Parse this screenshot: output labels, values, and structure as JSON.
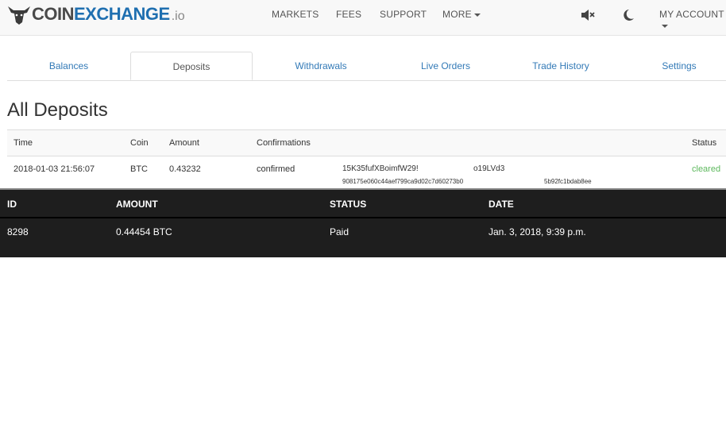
{
  "header": {
    "logo_coin": "COIN",
    "logo_exchange": "EXCHANGE",
    "logo_io": ".io",
    "nav": [
      "MARKETS",
      "FEES",
      "SUPPORT",
      "MORE"
    ],
    "account": "MY ACCOUNT"
  },
  "tabs": [
    "Balances",
    "Deposits",
    "Withdrawals",
    "Live Orders",
    "Trade History",
    "Settings"
  ],
  "page_title": "All Deposits",
  "deposits": {
    "columns": [
      "Time",
      "Coin",
      "Amount",
      "Confirmations",
      "Status"
    ],
    "row": {
      "time": "2018-01-03 21:56:07",
      "coin": "BTC",
      "amount": "0.43232",
      "confirmations": "confirmed",
      "address_start": "15K35fufXBoimfW29!",
      "address_end": "o19LVd3",
      "txid_start": "908175e060c44aef799ca9d02c7d60273b0",
      "txid_end": "5b92fc1bdab8ee",
      "status": "cleared"
    }
  },
  "overlay": {
    "columns": [
      "ID",
      "AMOUNT",
      "STATUS",
      "DATE"
    ],
    "row": {
      "id": "8298",
      "amount": "0.44454 BTC",
      "status": "Paid",
      "date": "Jan. 3, 2018, 9:39 p.m."
    }
  }
}
